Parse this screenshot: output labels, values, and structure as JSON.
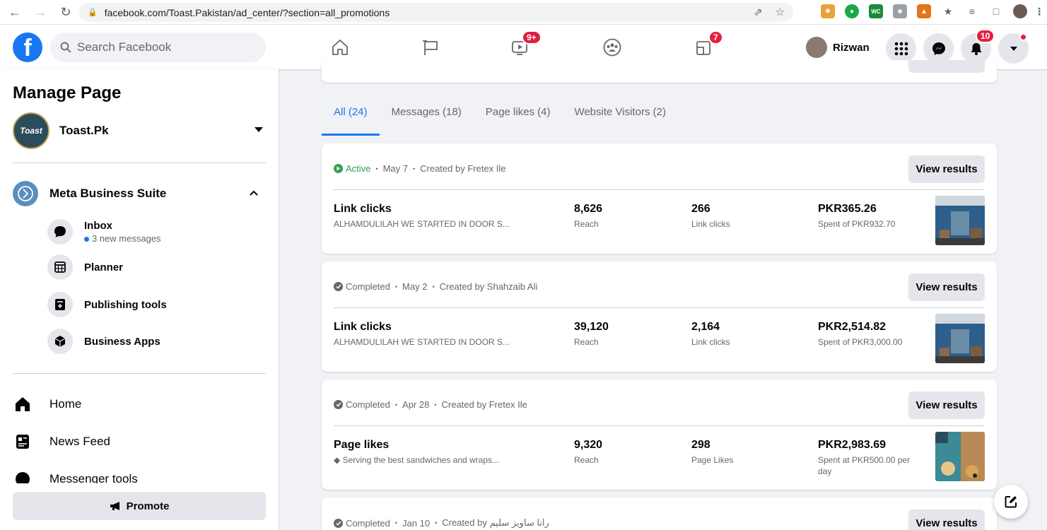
{
  "browser": {
    "url": "facebook.com/Toast.Pakistan/ad_center/?section=all_promotions"
  },
  "header": {
    "search_placeholder": "Search Facebook",
    "watch_badge": "9+",
    "gaming_badge": "7",
    "profile_name": "Rizwan",
    "notifications_badge": "10"
  },
  "sidebar": {
    "title": "Manage Page",
    "page_name": "Toast.Pk",
    "page_avatar_text": "Toast",
    "business_suite_label": "Meta Business Suite",
    "suite_items": [
      {
        "label": "Inbox",
        "sub": "3 new messages"
      },
      {
        "label": "Planner"
      },
      {
        "label": "Publishing tools"
      },
      {
        "label": "Business Apps"
      }
    ],
    "nav_items": [
      {
        "label": "Home"
      },
      {
        "label": "News Feed"
      },
      {
        "label": "Messenger tools"
      }
    ],
    "promote_label": "Promote"
  },
  "tabs": [
    {
      "label": "All (24)",
      "active": true
    },
    {
      "label": "Messages (18)"
    },
    {
      "label": "Page likes (4)"
    },
    {
      "label": "Website Visitors (2)"
    }
  ],
  "view_results_label": "View results",
  "promotions": [
    {
      "status": "Active",
      "date": "May 7",
      "created_by": "Created by Fretex Ile",
      "objective": "Link clicks",
      "text": "ALHAMDULILAH WE STARTED IN DOOR S...",
      "reach": "8,626",
      "reach_label": "Reach",
      "metric": "266",
      "metric_label": "Link clicks",
      "spent": "PKR365.26",
      "spent_label": "Spent of PKR932.70"
    },
    {
      "status": "Completed",
      "date": "May 2",
      "created_by": "Created by Shahzaib Ali",
      "objective": "Link clicks",
      "text": "ALHAMDULILAH WE STARTED IN DOOR S...",
      "reach": "39,120",
      "reach_label": "Reach",
      "metric": "2,164",
      "metric_label": "Link clicks",
      "spent": "PKR2,514.82",
      "spent_label": "Spent of PKR3,000.00"
    },
    {
      "status": "Completed",
      "date": "Apr 28",
      "created_by": "Created by Fretex Ile",
      "objective": "Page likes",
      "text": "Serving the best sandwiches and wraps...",
      "reach": "9,320",
      "reach_label": "Reach",
      "metric": "298",
      "metric_label": "Page Likes",
      "spent": "PKR2,983.69",
      "spent_label": "Spent at PKR500.00 per day"
    },
    {
      "status": "Completed",
      "date": "Jan 10",
      "created_by": "Created by رانا ساویز سلیم"
    }
  ],
  "colors": {
    "accent": "#1877f2",
    "active_status": "#31a24c",
    "badge": "#e41e3f"
  }
}
